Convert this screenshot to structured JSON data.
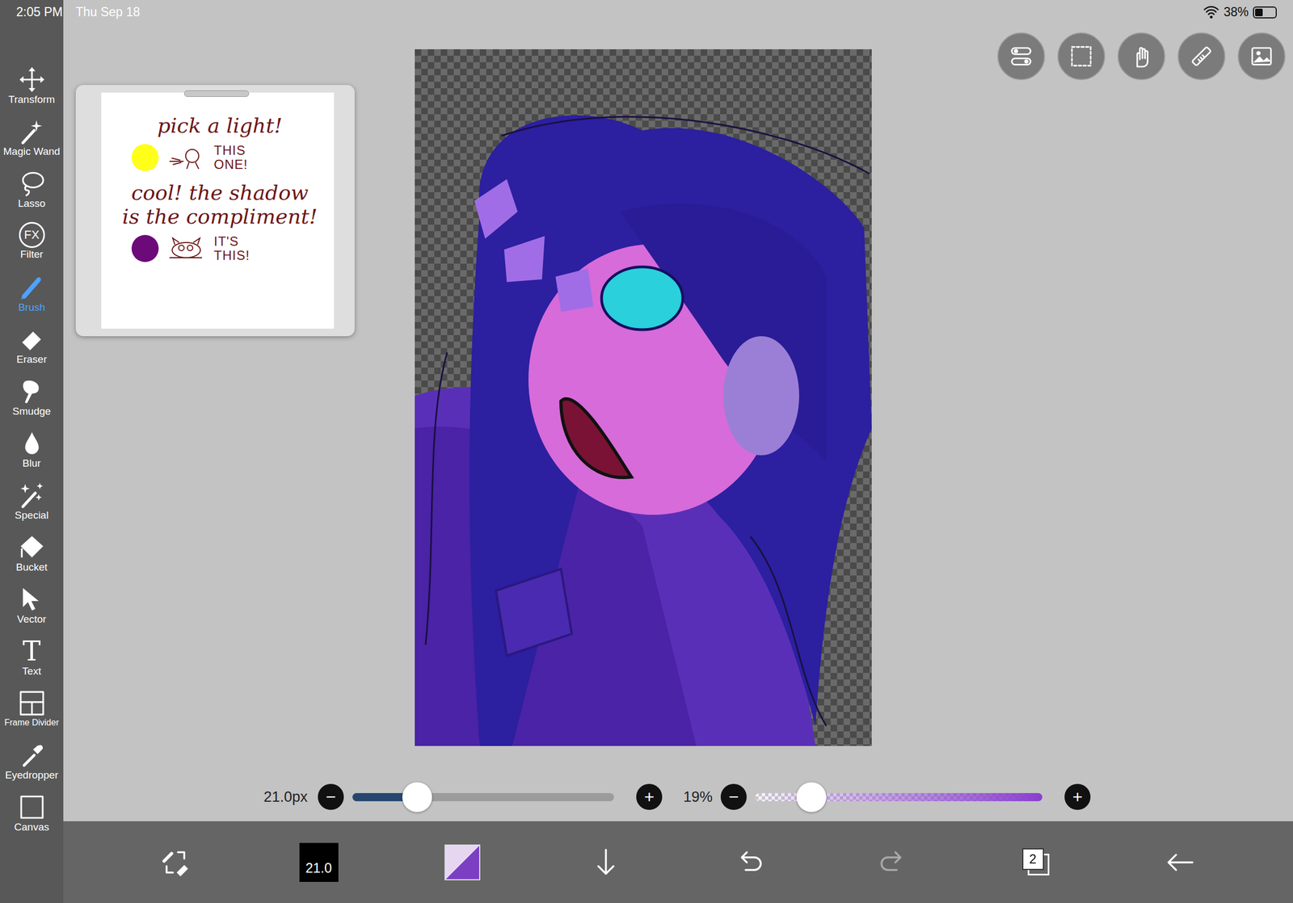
{
  "status_bar": {
    "time": "2:05 PM",
    "date": "Thu Sep 18",
    "battery": "38%",
    "battery_level": 0.38
  },
  "tools": [
    {
      "label": "Transform",
      "selected": false
    },
    {
      "label": "Magic Wand",
      "selected": false
    },
    {
      "label": "Lasso",
      "selected": false
    },
    {
      "label": "Filter",
      "selected": false,
      "icon_text": "FX"
    },
    {
      "label": "Brush",
      "selected": true
    },
    {
      "label": "Eraser",
      "selected": false
    },
    {
      "label": "Smudge",
      "selected": false
    },
    {
      "label": "Blur",
      "selected": false
    },
    {
      "label": "Special",
      "selected": false
    },
    {
      "label": "Bucket",
      "selected": false
    },
    {
      "label": "Vector",
      "selected": false
    },
    {
      "label": "Text",
      "selected": false,
      "icon_text": "T"
    },
    {
      "label": "Frame Divider",
      "selected": false
    },
    {
      "label": "Eyedropper",
      "selected": false
    },
    {
      "label": "Canvas",
      "selected": false
    }
  ],
  "reference": {
    "items": [
      {
        "kind": "heading",
        "lines": [
          "pick a light!"
        ]
      },
      {
        "kind": "swatch",
        "color": "#ffff1a",
        "lines": [
          "THIS",
          "ONE!"
        ]
      },
      {
        "kind": "heading",
        "lines": [
          "cool! the shadow",
          "is the compliment!"
        ]
      },
      {
        "kind": "swatch",
        "color": "#6b0a78",
        "lines": [
          "IT'S",
          "THIS!"
        ]
      }
    ]
  },
  "brush_size": {
    "reading": "21.0px",
    "level": 0.246,
    "minus": "−",
    "plus": "+"
  },
  "opacity": {
    "reading": "19%",
    "level": 0.195,
    "minus": "−",
    "plus": "+"
  },
  "bottom_bar": {
    "size_badge": "21.0",
    "layer_count": "2",
    "redo_disabled": true
  }
}
